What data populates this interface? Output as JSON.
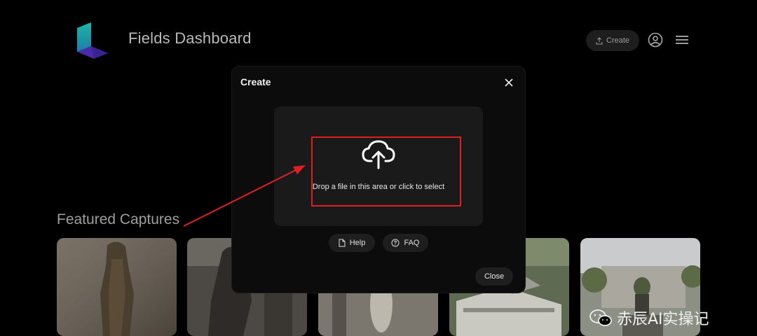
{
  "header": {
    "app_title": "Fields Dashboard",
    "create_label": "Create",
    "icons": {
      "logo": "fields-logo",
      "create": "upload-icon",
      "user": "user-circle-icon",
      "menu": "hamburger-icon"
    }
  },
  "featured": {
    "title": "Featured Captures",
    "thumbnails": [
      "capture-1",
      "capture-2",
      "capture-3",
      "capture-4",
      "capture-5"
    ]
  },
  "modal": {
    "title": "Create",
    "drop_text": "Drop a file in this area or click to select",
    "help_label": "Help",
    "faq_label": "FAQ",
    "close_label": "Close",
    "icons": {
      "close": "close-icon",
      "upload": "cloud-upload-icon",
      "help": "document-icon",
      "faq": "question-circle-icon"
    }
  },
  "annotation": {
    "color": "#e02020"
  },
  "watermark": {
    "text": "赤辰AI实操记",
    "icon": "wechat-icon"
  },
  "colors": {
    "background": "#000000",
    "modal": "#0c0c0c",
    "panel": "#1a1a1a",
    "accent_red": "#e02020"
  }
}
